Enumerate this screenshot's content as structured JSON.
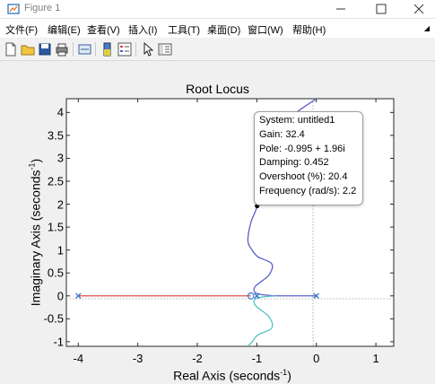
{
  "window": {
    "title": "Figure 1",
    "controls": [
      "minimize",
      "maximize",
      "close"
    ]
  },
  "menubar": {
    "items": [
      "文件(F)",
      "编辑(E)",
      "查看(V)",
      "插入(I)",
      "工具(T)",
      "桌面(D)",
      "窗口(W)",
      "帮助(H)"
    ]
  },
  "toolbar": {
    "buttons": [
      "new-figure-icon",
      "open-folder-icon",
      "save-icon",
      "print-icon",
      "link-plot-icon",
      "colorbar-icon",
      "legend-icon",
      "pointer-icon",
      "property-editor-icon"
    ]
  },
  "plot": {
    "title": "Root Locus",
    "xlabel": "Real Axis (seconds",
    "xlabel_sup": "-1",
    "xlabel_end": ")",
    "ylabel": "Imaginary Axis (seconds",
    "ylabel_sup": "-1",
    "ylabel_end": ")"
  },
  "datatip": {
    "lines": [
      "System: untitled1",
      "Gain: 32.4",
      "Pole: -0.995 + 1.96i",
      "Damping: 0.452",
      "Overshoot (%): 20.4",
      "Frequency (rad/s): 2.2"
    ]
  },
  "colors": {
    "branch_real": "#d9534f",
    "branch_upper": "#5b5fc7",
    "branch_lower": "#4fc3c8",
    "marker": "#2a6fc9"
  },
  "chart_data": {
    "type": "line",
    "title": "Root Locus",
    "xlabel": "Real Axis (seconds-1)",
    "ylabel": "Imaginary Axis (seconds-1)",
    "xlim": [
      -4.2,
      1.3
    ],
    "ylim": [
      -1.1,
      4.3
    ],
    "x_ticks": [
      -4,
      -3,
      -2,
      -1,
      0,
      1
    ],
    "y_ticks": [
      -1,
      -0.5,
      0,
      0.5,
      1,
      1.5,
      2,
      2.5,
      3,
      3.5,
      4
    ],
    "y_tick_labels": [
      "-1",
      "-0.5",
      "0",
      "0.5",
      "1",
      "1.5",
      "2",
      "2.5",
      "3",
      "3.5",
      "4"
    ],
    "grid": false,
    "series": [
      {
        "color": "#d9534f",
        "x": [
          -4,
          -1.1
        ],
        "y": [
          0,
          0
        ]
      },
      {
        "color": "#5b5fc7",
        "x": [
          -0.7,
          -1.0,
          -1.03,
          -0.8,
          -0.75,
          -0.98,
          -1.08,
          -1.15,
          -1.1,
          -0.995,
          -0.9,
          -0.75,
          -0.52,
          -0.0
        ],
        "y": [
          0,
          0.05,
          0.2,
          0.45,
          0.7,
          0.85,
          1.0,
          1.2,
          1.6,
          1.96,
          2.6,
          3.2,
          3.8,
          4.3
        ]
      },
      {
        "color": "#5b5fc7",
        "x": [
          -0.7,
          0.0
        ],
        "y": [
          0,
          0
        ]
      },
      {
        "color": "#4fc3c8",
        "x": [
          -0.7,
          -1.0,
          -1.03,
          -0.8,
          -0.75,
          -0.98,
          -1.08,
          -1.15
        ],
        "y": [
          0,
          -0.05,
          -0.2,
          -0.45,
          -0.7,
          -0.85,
          -1.0,
          -1.1
        ]
      }
    ],
    "poles": [
      {
        "x": -4,
        "y": 0
      },
      {
        "x": -1,
        "y": 0
      },
      {
        "x": 0,
        "y": 0
      }
    ],
    "zeros": [
      {
        "x": -1.1,
        "y": 0
      }
    ],
    "selected_point": {
      "x": -0.995,
      "y": 1.96
    }
  }
}
